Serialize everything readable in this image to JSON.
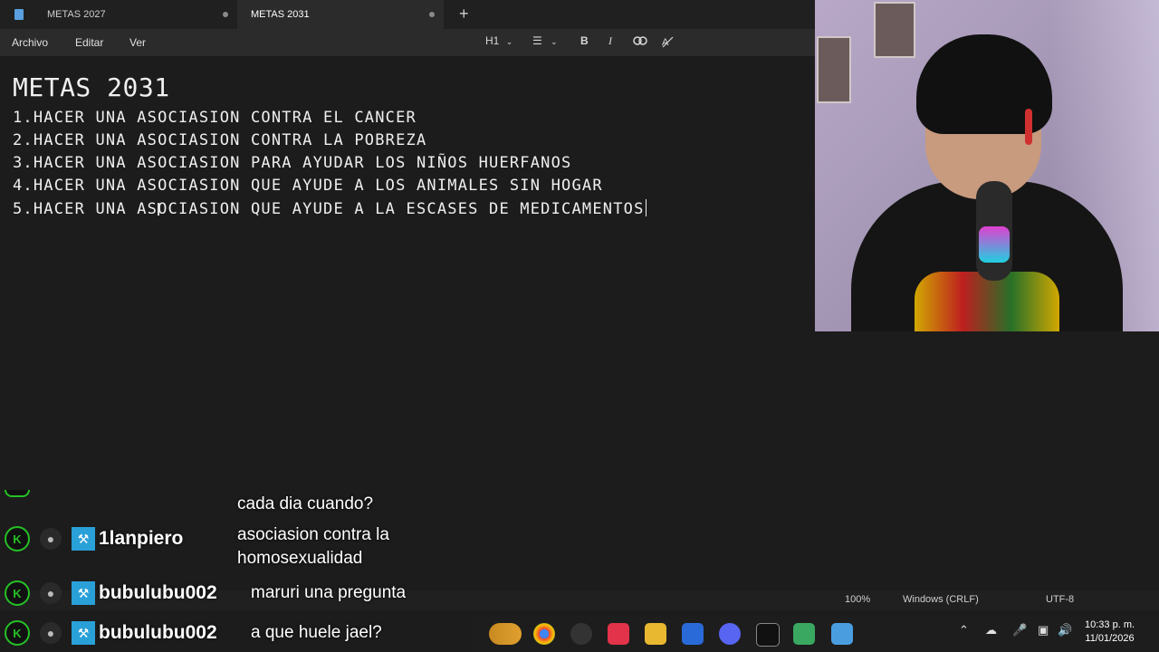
{
  "tabs": [
    {
      "title": "METAS 2027",
      "active": false
    },
    {
      "title": "METAS 2031",
      "active": true
    }
  ],
  "menu": {
    "file": "Archivo",
    "edit": "Editar",
    "view": "Ver"
  },
  "toolbar": {
    "heading": "H1",
    "bold": "B",
    "italic": "I"
  },
  "document": {
    "title": "METAS 2031",
    "lines": [
      "1.HACER UNA ASOCIASION CONTRA EL CANCER",
      "2.HACER UNA ASOCIASION CONTRA LA POBREZA",
      "3.HACER UNA ASOCIASION PARA AYUDAR LOS NIÑOS HUERFANOS",
      "4.HACER UNA ASOCIASION QUE AYUDE A LOS ANIMALES SIN HOGAR",
      "5.HACER UNA ASOCIASION QUE AYUDE A LA ESCASES DE MEDICAMENTOS"
    ]
  },
  "status": {
    "zoom": "100%",
    "line_ending": "Windows (CRLF)",
    "encoding": "UTF-8"
  },
  "chat": [
    {
      "user": "",
      "message": "cada dia cuando?"
    },
    {
      "user": "1lanpiero",
      "message": "asociasion contra la homosexualidad"
    },
    {
      "user": "bubulubu002",
      "message": "maruri una pregunta"
    },
    {
      "user": "bubulubu002",
      "message": "a que huele jael?"
    }
  ],
  "clock": {
    "time": "10:33 p. m.",
    "date": "11/01/2026"
  },
  "colors": {
    "editor_bg": "#1c1c1c",
    "tab_active": "#2b2b2b",
    "chat_badge": "#25c025",
    "mod_badge": "#2aa0d8"
  }
}
